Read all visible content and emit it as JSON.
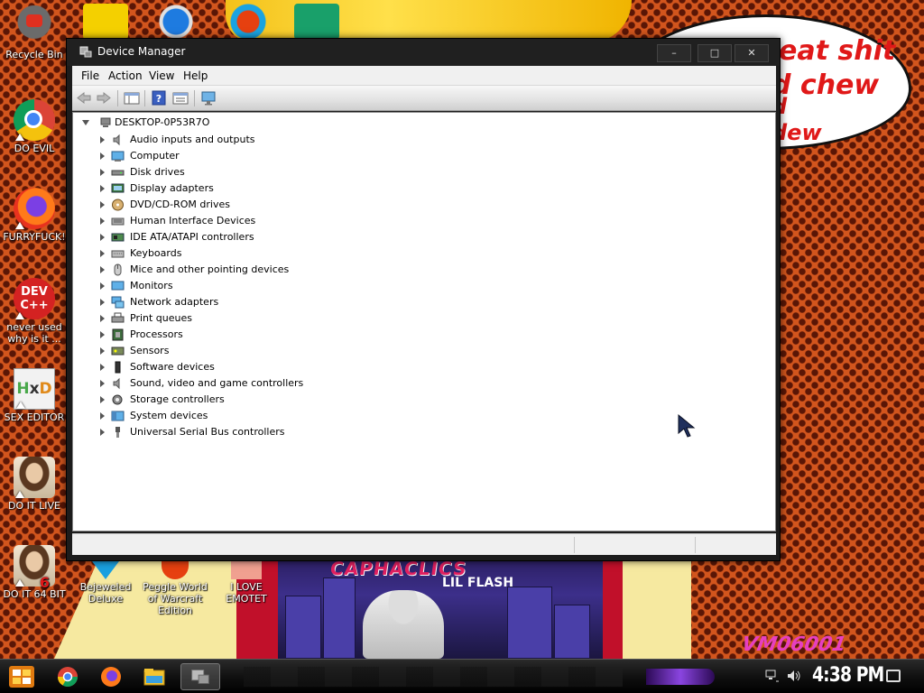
{
  "window": {
    "title": "Device Manager",
    "buttons": {
      "minimize": "–",
      "maximize": "□",
      "close": "✕"
    }
  },
  "menu": [
    "File",
    "Action",
    "View",
    "Help"
  ],
  "toolbar_icons": [
    "back-icon",
    "forward-icon",
    "properties-icon",
    "help-icon",
    "console-tree-icon",
    "monitor-icon"
  ],
  "tree": {
    "root": "DESKTOP-0P53R7O",
    "nodes": [
      {
        "label": "Audio inputs and outputs",
        "icon": "speaker-icon"
      },
      {
        "label": "Computer",
        "icon": "computer-icon"
      },
      {
        "label": "Disk drives",
        "icon": "disk-drive-icon"
      },
      {
        "label": "Display adapters",
        "icon": "display-adapter-icon"
      },
      {
        "label": "DVD/CD-ROM drives",
        "icon": "dvd-drive-icon"
      },
      {
        "label": "Human Interface Devices",
        "icon": "hid-icon"
      },
      {
        "label": "IDE ATA/ATAPI controllers",
        "icon": "ide-controller-icon"
      },
      {
        "label": "Keyboards",
        "icon": "keyboard-icon"
      },
      {
        "label": "Mice and other pointing devices",
        "icon": "mouse-icon"
      },
      {
        "label": "Monitors",
        "icon": "monitor-icon"
      },
      {
        "label": "Network adapters",
        "icon": "network-adapter-icon"
      },
      {
        "label": "Print queues",
        "icon": "printer-icon"
      },
      {
        "label": "Processors",
        "icon": "processor-icon"
      },
      {
        "label": "Sensors",
        "icon": "sensor-icon"
      },
      {
        "label": "Software devices",
        "icon": "software-device-icon"
      },
      {
        "label": "Sound, video and game controllers",
        "icon": "sound-controller-icon"
      },
      {
        "label": "Storage controllers",
        "icon": "storage-controller-icon"
      },
      {
        "label": "System devices",
        "icon": "system-devices-icon"
      },
      {
        "label": "Universal Serial Bus controllers",
        "icon": "usb-icon"
      }
    ]
  },
  "desktop_icons": [
    {
      "label": "Recycle Bin",
      "icon": "recycle-bin-icon"
    },
    {
      "label": "DO EVIL",
      "icon": "chrome-icon"
    },
    {
      "label": "FURRYFUCK!",
      "icon": "firefox-icon"
    },
    {
      "label": "never used why is it ...",
      "icon": "dev-cpp-icon"
    },
    {
      "label": "SEX EDITOR",
      "icon": "hxd-icon"
    },
    {
      "label": "DO IT LIVE",
      "icon": "portrait-icon"
    },
    {
      "label": "DO IT 64 BIT",
      "icon": "portrait-icon"
    },
    {
      "label": "Bejeweled Deluxe",
      "icon": "bejeweled-icon"
    },
    {
      "label": "Peggle World of Warcraft Edition",
      "icon": "peggle-icon"
    },
    {
      "label": "I LOVE EMOTET",
      "icon": "emotet-icon"
    }
  ],
  "wallpaper": {
    "bubble_lines": [
      "eat shit",
      "d chew",
      "d",
      "dew"
    ],
    "poster_title": "CAPHACLICS",
    "poster_subtitle": "LIL FLASH",
    "signature": "VM06001"
  },
  "taskbar": {
    "apps": [
      "start-icon",
      "chrome-icon",
      "firefox-icon",
      "explorer-icon",
      "device-manager-icon"
    ],
    "clock": "4:38 PM",
    "tray": [
      "network-icon",
      "volume-icon",
      "notification-icon"
    ]
  },
  "colors": {
    "wallpaper_orange": "#d2551d",
    "window_frame": "#1c1c1c",
    "taskbar": "#111111",
    "bubble_text": "#e01818"
  }
}
